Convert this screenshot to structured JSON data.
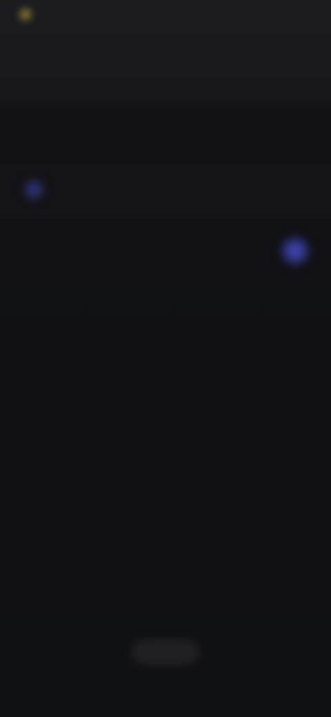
{
  "status_bar": {
    "left_text": "",
    "right_text": ""
  },
  "page": {
    "title": ""
  },
  "search": {
    "placeholder": ""
  },
  "section": {
    "header_label": ""
  },
  "list": {
    "items": [
      {
        "label": ""
      },
      {
        "label": ""
      },
      {
        "label": ""
      },
      {
        "label": ""
      },
      {
        "label": ""
      },
      {
        "label": ""
      },
      {
        "label": ""
      },
      {
        "label": ""
      }
    ]
  },
  "footer": {
    "button_label": ""
  },
  "colors": {
    "background": "#0f1014",
    "accent": "#4c4fc0",
    "status_dot": "#b79b3b"
  },
  "icons": {
    "status": "status-dot-icon",
    "search": "search-icon",
    "toggle": "toggle-knob-icon"
  }
}
